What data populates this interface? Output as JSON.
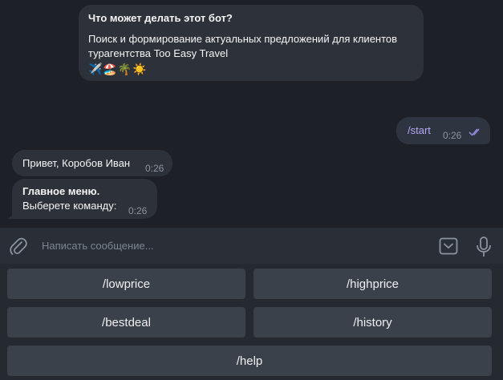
{
  "bot_info": {
    "title": "Что может делать этот бот?",
    "description": "Поиск и формирование актуальных предложений для клиентов турагентства Too Easy Travel",
    "emojis": "✈️🏖️🌴☀️"
  },
  "messages": [
    {
      "text": "/start",
      "time": "0:26",
      "status": "read"
    },
    {
      "text": "Привет, Коробов Иван",
      "time": "0:26"
    },
    {
      "title": "Главное меню.",
      "text": "Выберете команду:",
      "time": "0:26"
    }
  ],
  "input": {
    "placeholder": "Написать сообщение..."
  },
  "keyboard": {
    "buttons": [
      "/lowprice",
      "/highprice",
      "/bestdeal",
      "/history",
      "/help"
    ]
  },
  "colors": {
    "background": "#1d2127",
    "bubble": "#2d3139",
    "command_accent": "#b7a7f3",
    "keyboard_button": "#3a414b"
  },
  "icons": [
    "attach-icon",
    "keyboard-toggle-icon",
    "microphone-icon",
    "double-check-icon"
  ]
}
